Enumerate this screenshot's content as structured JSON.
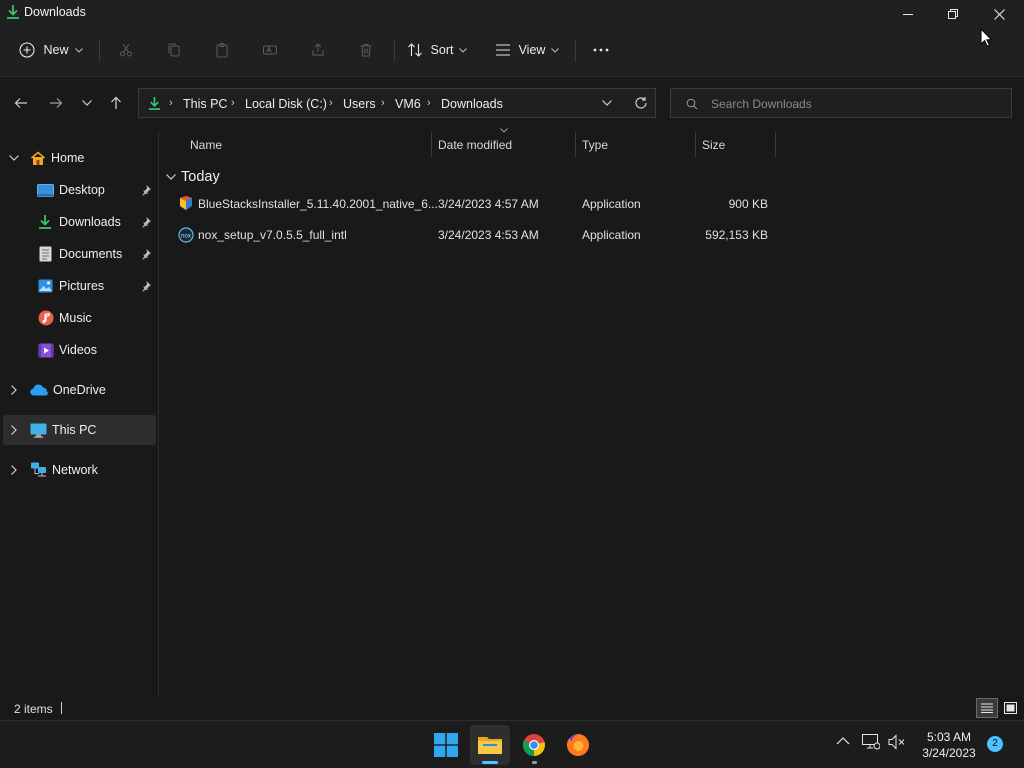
{
  "window": {
    "title": "Downloads"
  },
  "toolbar": {
    "new_label": "New",
    "sort_label": "Sort",
    "view_label": "View"
  },
  "breadcrumb": [
    "This PC",
    "Local Disk (C:)",
    "Users",
    "VM6",
    "Downloads"
  ],
  "search": {
    "placeholder": "Search Downloads"
  },
  "sidebar": {
    "items": [
      {
        "label": "Home",
        "icon": "home-icon"
      },
      {
        "label": "Desktop",
        "icon": "desktop-icon",
        "pinned": true
      },
      {
        "label": "Downloads",
        "icon": "downloads-icon",
        "pinned": true
      },
      {
        "label": "Documents",
        "icon": "documents-icon",
        "pinned": true
      },
      {
        "label": "Pictures",
        "icon": "pictures-icon",
        "pinned": true
      },
      {
        "label": "Music",
        "icon": "music-icon"
      },
      {
        "label": "Videos",
        "icon": "videos-icon"
      },
      {
        "label": "OneDrive",
        "icon": "onedrive-icon"
      },
      {
        "label": "This PC",
        "icon": "this-pc-icon",
        "selected": true
      },
      {
        "label": "Network",
        "icon": "network-icon"
      }
    ]
  },
  "columns": {
    "name": "Name",
    "date": "Date modified",
    "type": "Type",
    "size": "Size"
  },
  "group": {
    "label": "Today"
  },
  "files": [
    {
      "name": "BlueStacksInstaller_5.11.40.2001_native_6...",
      "date": "3/24/2023 4:57 AM",
      "type": "Application",
      "size": "900 KB",
      "icon": "bluestacks-icon"
    },
    {
      "name": "nox_setup_v7.0.5.5_full_intl",
      "date": "3/24/2023 4:53 AM",
      "type": "Application",
      "size": "592,153 KB",
      "icon": "nox-icon"
    }
  ],
  "status": {
    "items_count": "2 items"
  },
  "taskbar": {
    "time": "5:03 AM",
    "date": "3/24/2023",
    "notification_count": "2"
  },
  "colors": {
    "accent": "#4cc2ff",
    "background": "#191919",
    "chrome": "#202020",
    "selected": "#2d2d2d"
  }
}
